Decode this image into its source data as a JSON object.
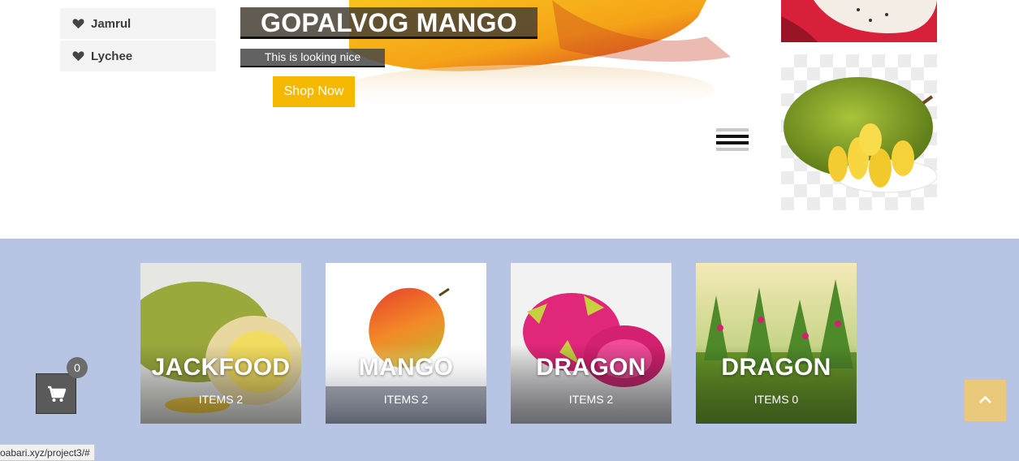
{
  "sidebar": {
    "items": [
      {
        "label": "Jamrul",
        "icon": "heart-icon"
      },
      {
        "label": "Lychee",
        "icon": "heart-icon"
      }
    ]
  },
  "hero": {
    "title": "GOPALVOG MANGO",
    "subtitle": "This is looking nice",
    "button_label": "Shop Now"
  },
  "categories": [
    {
      "name": "JACKFOOD",
      "count_label": "ITEMS 2"
    },
    {
      "name": "MANGO",
      "count_label": "ITEMS 2"
    },
    {
      "name": "DRAGON",
      "count_label": "ITEMS 2"
    },
    {
      "name": "DRAGON",
      "count_label": "ITEMS 0"
    }
  ],
  "cart": {
    "count": "0",
    "icon": "shopping-cart-icon"
  },
  "scroll_top": {
    "icon": "chevron-up-icon"
  },
  "status_bar": {
    "url": "oabari.xyz/project3/#"
  },
  "colors": {
    "accent": "#f5b800",
    "band_background": "#b7c4e3",
    "scroll_button": "#ebc97a",
    "sidebar_background": "#f4f4f4"
  }
}
